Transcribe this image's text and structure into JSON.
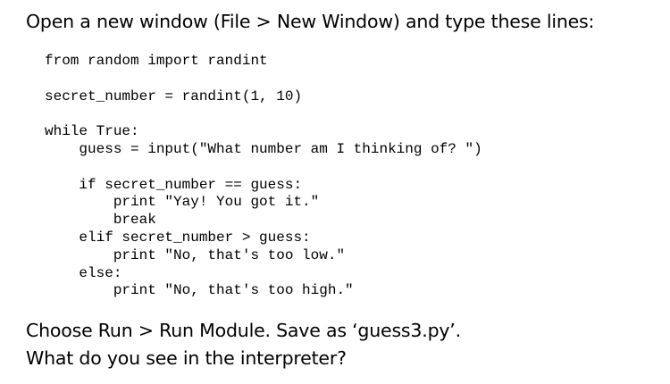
{
  "heading": "Open a new window (File > New Window) and type these lines:",
  "code_lines": [
    "from random import randint",
    "",
    "secret_number = randint(1, 10)",
    "",
    "while True:",
    "    guess = input(\"What number am I thinking of? \")",
    "",
    "    if secret_number == guess:",
    "        print \"Yay! You got it.\"",
    "        break",
    "    elif secret_number > guess:",
    "        print \"No, that's too low.\"",
    "    else:",
    "        print \"No, that's too high.\""
  ],
  "footer": {
    "line1": "Choose Run > Run Module.  Save as ‘guess3.py’.",
    "line2": "What do you see in the interpreter?"
  }
}
